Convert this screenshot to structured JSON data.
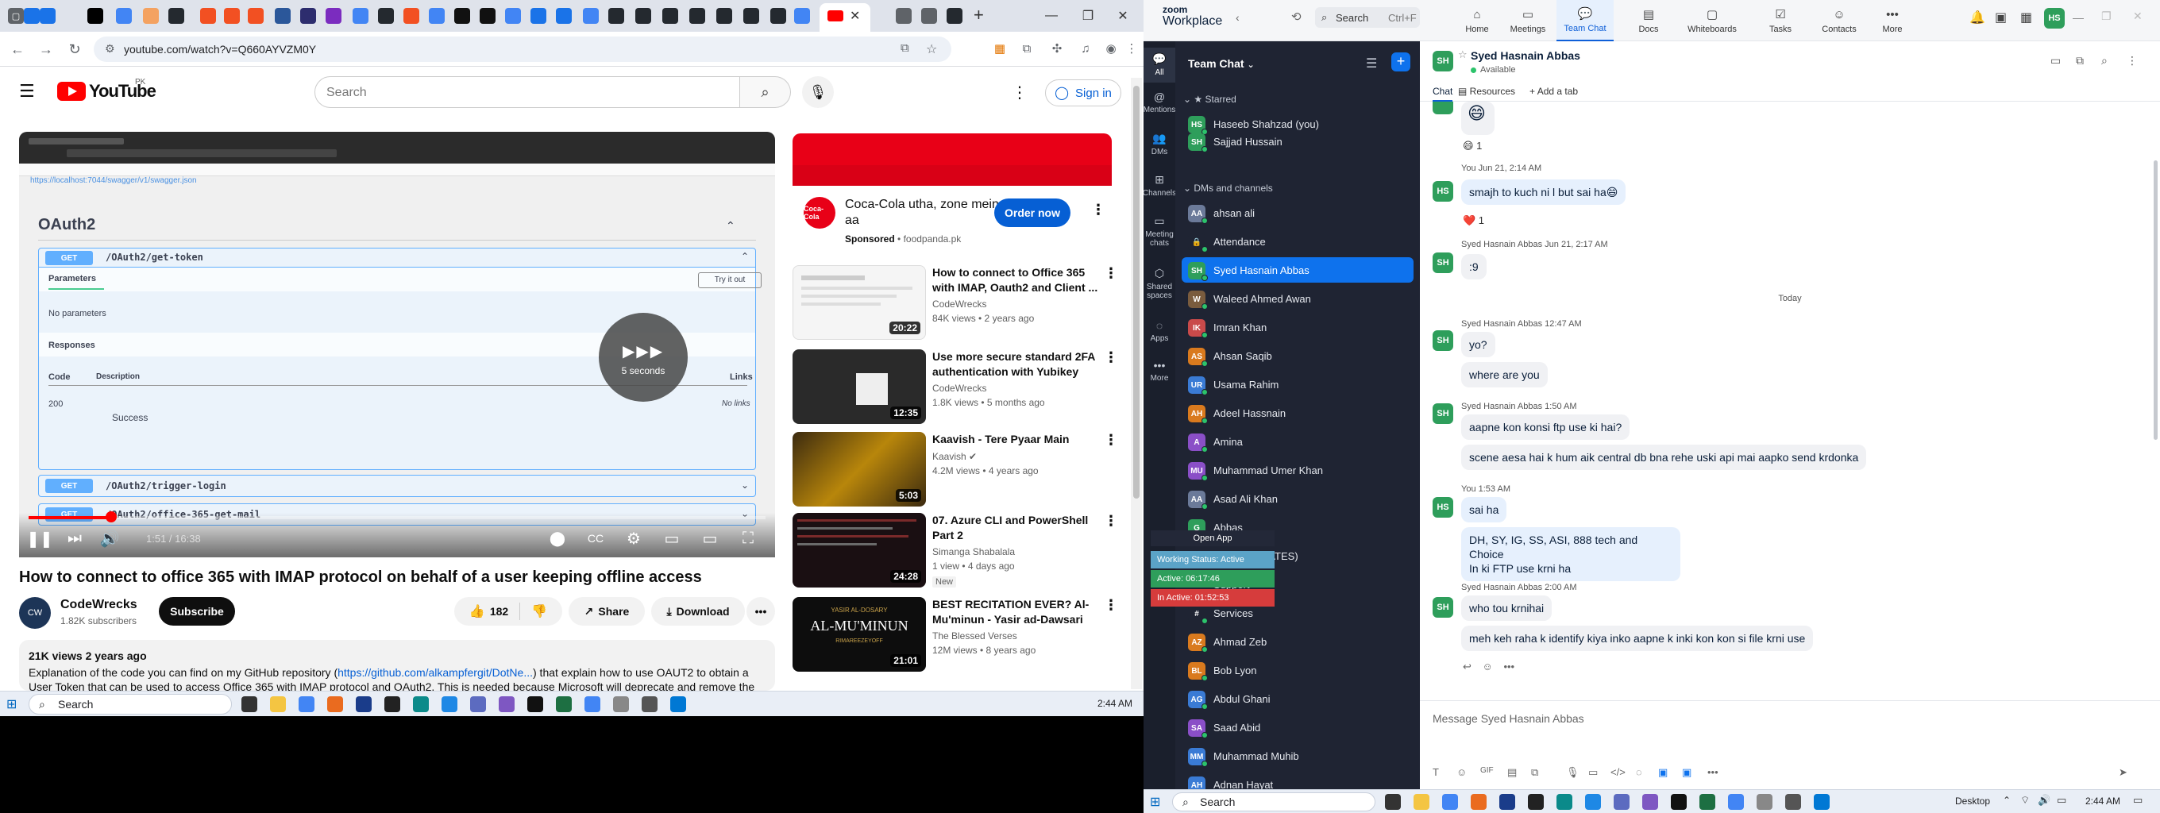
{
  "browser": {
    "url": "youtube.com/watch?v=Q660AYVZM0Y"
  },
  "youtube": {
    "logo_text": "YouTube",
    "logo_region": "PK",
    "search_placeholder": "Search",
    "signin_label": "Sign in",
    "player": {
      "swagger_link": "https://localhost:7044/swagger/v1/swagger.json",
      "section_title": "OAuth2",
      "endpoint1_method": "GET",
      "endpoint1_path": "/OAuth2/get-token",
      "parameters_label": "Parameters",
      "try_it_out": "Try it out",
      "no_parameters": "No parameters",
      "responses_label": "Responses",
      "code_label": "Code",
      "description_label": "Description",
      "links_label": "Links",
      "response_code": "200",
      "response_desc": "Success",
      "no_links": "No links",
      "endpoint2_method": "GET",
      "endpoint2_path": "/OAuth2/trigger-login",
      "endpoint3_method": "GET",
      "endpoint3_path": "/OAuth2/office-365-get-mail",
      "overlay_text": "5 seconds",
      "time_display": "1:51 / 16:38",
      "progress": 0.112
    },
    "video_title": "How to connect to office 365 with IMAP protocol on behalf of a user keeping offline access",
    "channel_name": "CodeWrecks",
    "channel_subs": "1.82K subscribers",
    "subscribe_label": "Subscribe",
    "like_count": "182",
    "share_label": "Share",
    "download_label": "Download",
    "desc_views": "21K views  2 years ago",
    "desc_text_1": "Explanation of the code you can find on my GitHub repository (",
    "desc_link": "https://github.com/alkampfergit/DotNe...",
    "desc_text_2": ") that explain how to use OAUT2 to obtain a User Token that can be used to access Office 365 with IMAP protocol and OAuth2. This is needed because Microsoft will deprecate and remove the",
    "ad": {
      "title": "Coca-Cola utha, zone mein aa",
      "sponsored": "Sponsored",
      "domain": "foodpanda.pk",
      "button": "Order now",
      "logo_text": "Coca-Cola"
    },
    "recommendations": [
      {
        "title": "How to connect  to Office 365 with IMAP, Oauth2 and Client ...",
        "channel": "CodeWrecks",
        "meta": "84K views • 2 years ago",
        "duration": "20:22",
        "badge": ""
      },
      {
        "title": "Use more secure standard 2FA authentication with Yubikey an...",
        "channel": "CodeWrecks",
        "meta": "1.8K views • 5 months ago",
        "duration": "12:35",
        "badge": ""
      },
      {
        "title": "Kaavish - Tere Pyaar Main",
        "channel": "Kaavish",
        "meta": "4.2M views • 4 years ago",
        "duration": "5:03",
        "badge": ""
      },
      {
        "title": "07. Azure CLI and PowerShell Part 2",
        "channel": "Simanga Shabalala",
        "meta": "1 view • 4 days ago",
        "duration": "24:28",
        "badge": "New"
      },
      {
        "title": "BEST RECITATION EVER? Al-Mu'minun - Yasir ad-Dawsari",
        "channel": "The Blessed Verses",
        "meta": "12M views • 8 years ago",
        "duration": "21:01",
        "badge": ""
      }
    ],
    "rec5_thumb_line1": "YASIR AL-DOSARY",
    "rec5_thumb_line2": "AL-MU'MINUN",
    "rec5_thumb_line3": "RIMAREEZEYOFF"
  },
  "taskbar_left": {
    "search": "Search",
    "time": "2:44 AM"
  },
  "zoom": {
    "brand_top": "zoom",
    "brand_bottom": "Workplace",
    "search": "Search",
    "search_shortcut": "Ctrl+F",
    "avatar_initials": "HS",
    "nav": [
      {
        "label": "Home"
      },
      {
        "label": "Meetings"
      },
      {
        "label": "Team Chat"
      },
      {
        "label": "Docs"
      },
      {
        "label": "Whiteboards"
      },
      {
        "label": "Tasks"
      },
      {
        "label": "Contacts"
      },
      {
        "label": "More"
      }
    ],
    "rail": [
      {
        "label": "All"
      },
      {
        "label": "Mentions"
      },
      {
        "label": "DMs"
      },
      {
        "label": "Channels"
      },
      {
        "label": "Meeting chats"
      },
      {
        "label": "Shared spaces"
      },
      {
        "label": "Apps"
      },
      {
        "label": "More"
      }
    ],
    "list_title": "Team Chat",
    "starred_label": "Starred",
    "dms_label": "DMs and channels",
    "starred": [
      {
        "initials": "HS",
        "name": "Haseeb Shahzad (you)",
        "color": "#2e9e5b"
      },
      {
        "initials": "SH",
        "name": "Sajjad Hussain",
        "color": "#2e9e5b"
      }
    ],
    "dms": [
      {
        "initials": "AA",
        "name": "ahsan ali",
        "color": "#6b7a99"
      },
      {
        "initials": "🔒",
        "name": "Attendance",
        "color": "#1f2433"
      },
      {
        "initials": "SH",
        "name": "Syed Hasnain Abbas",
        "color": "#2e9e5b"
      },
      {
        "initials": "W",
        "name": "Waleed Ahmed Awan",
        "color": "#7a5c3e"
      },
      {
        "initials": "IK",
        "name": "Imran Khan",
        "color": "#c94a4a"
      },
      {
        "initials": "AS",
        "name": "Ahsan Saqib",
        "color": "#d97a1e"
      },
      {
        "initials": "UR",
        "name": "Usama Rahim",
        "color": "#3a7bd5"
      },
      {
        "initials": "AH",
        "name": "Adeel Hassnain",
        "color": "#d97a1e"
      },
      {
        "initials": "A",
        "name": "Amina",
        "color": "#8a4fc7"
      },
      {
        "initials": "MU",
        "name": "Muhammad Umer Khan",
        "color": "#8a4fc7"
      },
      {
        "initials": "AA",
        "name": "Asad Ali Khan",
        "color": "#6b7a99"
      },
      {
        "initials": "G",
        "name": "Abbas",
        "color": "#2e9e5b"
      },
      {
        "initials": "#",
        "name": "Portal (UPDATES)",
        "color": "#1f2433"
      },
      {
        "initials": "#",
        "name": "Support",
        "color": "#1f2433"
      },
      {
        "initials": "#",
        "name": "Services",
        "color": "#1f2433"
      },
      {
        "initials": "AZ",
        "name": "Ahmad Zeb",
        "color": "#d97a1e"
      },
      {
        "initials": "BL",
        "name": "Bob Lyon",
        "color": "#d97a1e"
      },
      {
        "initials": "AG",
        "name": "Abdul Ghani",
        "color": "#3a7bd5"
      },
      {
        "initials": "SA",
        "name": "Saad Abid",
        "color": "#8a4fc7"
      },
      {
        "initials": "MM",
        "name": "Muhammad Muhib",
        "color": "#3a7bd5"
      },
      {
        "initials": "AH",
        "name": "Adnan Hayat",
        "color": "#3a7bd5"
      }
    ],
    "chat_name": "Syed Hasnain Abbas",
    "chat_status": "Available",
    "chat_initials": "SH",
    "subtabs": [
      "Chat",
      "Resources",
      "Add a tab"
    ],
    "messages": {
      "r1": "😄 1",
      "m1_meta": "You  Jun 21, 2:14 AM",
      "m1_text": "smajh to kuch ni l but sai ha😄",
      "r2": "❤️ 1",
      "m2_meta": "Syed Hasnain Abbas  Jun 21, 2:17 AM",
      "m2_text": ":9",
      "day": "Today",
      "m3_meta": "Syed Hasnain Abbas  12:47 AM",
      "m3_text": "yo?",
      "m3b_text": "where are you",
      "m4_meta": "Syed Hasnain Abbas  1:50 AM",
      "m4_text": "aapne kon konsi ftp use ki hai?",
      "m4b_text": "scene aesa hai k hum aik central db bna rehe uski api mai aapko send krdonka",
      "m5_meta": "You  1:53 AM",
      "m5_text": "sai ha",
      "m5b_line1": "DH, SY, IG, SS, ASI, 888 tech and Choice",
      "m5b_line2": "In ki FTP use krni ha",
      "m6_meta": "Syed Hasnain Abbas  2:00 AM",
      "m6_text": "who tou krnihai",
      "m6b_text": "meh keh raha k identify kiya inko aapne k inki  kon kon si file krni use"
    },
    "composer_placeholder": "Message Syed Hasnain Abbas",
    "working_status": {
      "tooltip": "Open App",
      "status": "Working Status: Active",
      "active": "Active: 06:17:46",
      "inactive": "In Active: 01:52:53"
    }
  },
  "taskbar_right": {
    "search": "Search",
    "desktop": "Desktop",
    "time": "2:44 AM"
  }
}
